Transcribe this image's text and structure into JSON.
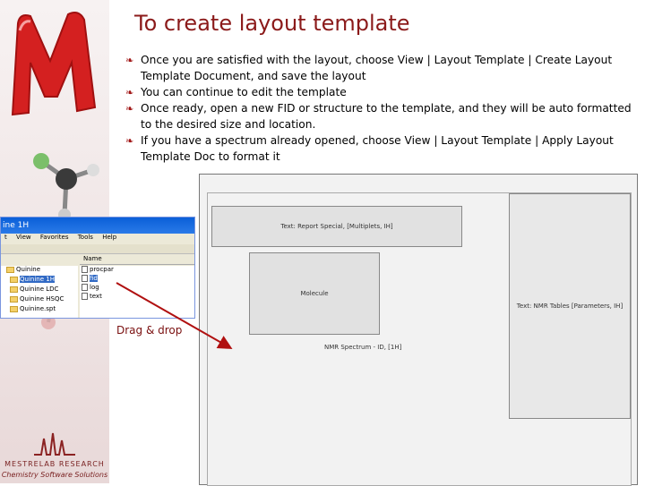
{
  "brand": {
    "line1": "MESTRELAB RESEARCH",
    "line2": "Chemistry Software Solutions"
  },
  "colors": {
    "title": "#8b1a1a",
    "bullet": "#a01414",
    "logo_red": "#d42020",
    "explorer_titlebar": "#0a5fd8"
  },
  "slide": {
    "title": "To create layout template",
    "bullets": [
      "Once you are satisfied with the layout, choose View | Layout Template | Create Layout Template Document, and save the layout",
      "You can continue to edit the template",
      "Once ready, open a new FID or structure to the template, and they will be auto formatted to the desired size and location.",
      "If you have a spectrum already opened, choose View | Layout Template | Apply Layout Template Doc to format it"
    ]
  },
  "template": {
    "report_box": "Text: Report Special, [Multiplets, IH]",
    "molecule_box": "Molecule",
    "nmr_table_box": "Text: NMR Tables [Parameters, IH]",
    "spectrum_label": "NMR Spectrum - ID, [1H]"
  },
  "explorer": {
    "title": "ine 1H",
    "menu": [
      "t",
      "View",
      "Favorites",
      "Tools",
      "Help"
    ],
    "column_header": "Name",
    "tree": [
      "Quinine",
      "Quinine 1H",
      "Quinine LDC",
      "Quinine HSQC",
      "Quinine.spt"
    ],
    "files": [
      "procpar",
      "fid",
      "log",
      "text"
    ]
  },
  "drag_label": "Drag & drop"
}
